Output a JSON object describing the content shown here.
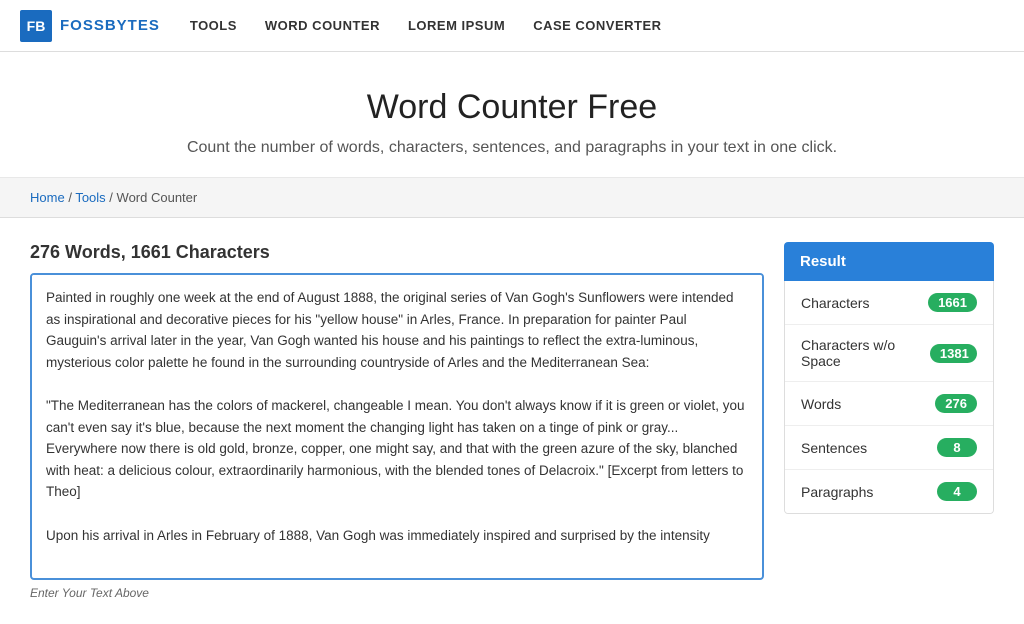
{
  "nav": {
    "logo_letters": "FB",
    "logo_text": "FOSSBYTES",
    "links": [
      "TOOLS",
      "WORD COUNTER",
      "LOREM IPSUM",
      "CASE CONVERTER"
    ]
  },
  "hero": {
    "title": "Word Counter Free",
    "subtitle": "Count the number of words, characters, sentences, and paragraphs in your text in one click."
  },
  "breadcrumb": {
    "home": "Home",
    "tools": "Tools",
    "current": "Word Counter"
  },
  "editor": {
    "summary": "276 Words, 1661 Characters",
    "text": "Painted in roughly one week at the end of August 1888, the original series of Van Gogh's Sunflowers were intended as inspirational and decorative pieces for his \"yellow house\" in Arles, France. In preparation for painter Paul Gauguin's arrival later in the year, Van Gogh wanted his house and his paintings to reflect the extra-luminous, mysterious color palette he found in the surrounding countryside of Arles and the Mediterranean Sea:\n\n\"The Mediterranean has the colors of mackerel, changeable I mean. You don't always know if it is green or violet, you can't even say it's blue, because the next moment the changing light has taken on a tinge of pink or gray... Everywhere now there is old gold, bronze, copper, one might say, and that with the green azure of the sky, blanched with heat: a delicious colour, extraordinarily harmonious, with the blended tones of Delacroix.\" [Excerpt from letters to Theo]\n\nUpon his arrival in Arles in February of 1888, Van Gogh was immediately inspired and surprised by the intensity",
    "hint": "Enter Your Text Above"
  },
  "results": {
    "header": "Result",
    "rows": [
      {
        "label": "Characters",
        "value": "1661"
      },
      {
        "label": "Characters w/o Space",
        "value": "1381"
      },
      {
        "label": "Words",
        "value": "276"
      },
      {
        "label": "Sentences",
        "value": "8"
      },
      {
        "label": "Paragraphs",
        "value": "4"
      }
    ]
  }
}
